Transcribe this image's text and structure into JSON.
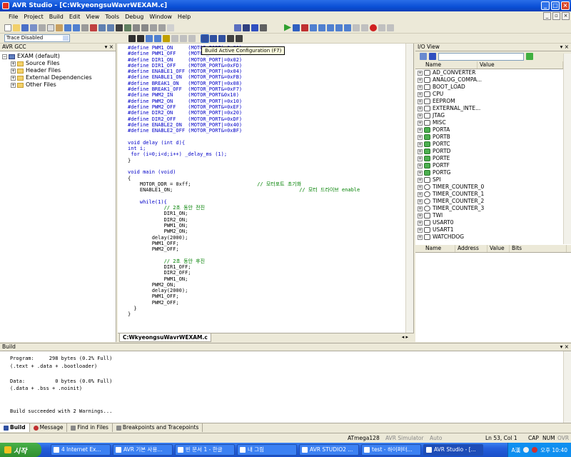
{
  "window": {
    "title": "AVR Studio - [C:WkyeongsuWavrWEXAM.c]"
  },
  "menu": [
    "File",
    "Project",
    "Build",
    "Edit",
    "View",
    "Tools",
    "Debug",
    "Window",
    "Help"
  ],
  "toolbar": {
    "trace": "Trace Disabled"
  },
  "tooltip": "Build Active Configuration (F7)",
  "left_pane": {
    "title": "AVR GCC",
    "root": "EXAM (default)",
    "items": [
      "Source Files",
      "Header Files",
      "External Dependencies",
      "Other Files"
    ]
  },
  "editor": {
    "tab": "C:WkyeongsuWavrWEXAM.c",
    "lines": [
      "#define PWM1_ON     (MOTOR_PORT|=0x01)",
      "#define PWM1_OFF    (MOTOR_PORT&=0xFE)",
      "#define DIR1_ON     (MOTOR_PORT|=0x02)",
      "#define DIR1_OFF    (MOTOR_PORT&=0xFD)",
      "#define ENABLE1_OFF (MOTOR_PORT|=0x04)",
      "#define ENABLE1_ON  (MOTOR_PORT&=0xFB)",
      "#define BREAK1_ON   (MOTOR_PORT|=0x08)",
      "#define BREAK1_OFF  (MOTOR_PORT&=0xF7)",
      "#define PWM2_IN     (MOTOR_PORT&0x10)",
      "#define PWM2_ON     (MOTOR_PORT|=0x10)",
      "#define PWM2_OFF    (MOTOR_PORT&=0xEF)",
      "#define DIR2_ON     (MOTOR_PORT|=0x20)",
      "#define DIR2_OFF    (MOTOR_PORT&=0xDF)",
      "#define ENABLE2_ON  (MOTOR_PORT|=0x40)",
      "#define ENABLE2_OFF (MOTOR_PORT&=0xBF)",
      "",
      "void delay (int d){",
      "int i;",
      " for (i=0;i<d;i++) _delay_ms (1);",
      "}",
      "",
      "void main (void)",
      "{",
      "    MOTOR_DDR = 0xff;                      // 모터포트 초기화",
      "    ENABLE1_ON;                                          // 모터 드라이브 enable",
      "",
      "    while(1){",
      "            // 2초 동안 전진",
      "            DIR1_ON;",
      "            DIR2_ON;",
      "            PWM1_ON;",
      "            PWM2_ON;",
      "        delay(2000);",
      "        PWM1_OFF;",
      "        PWM2_OFF;",
      "",
      "            // 2초 동안 후진",
      "            DIR1_OFF;",
      "            DIR2_OFF;",
      "            PWM1_ON;",
      "        PWM2_ON;",
      "        delay(2000);",
      "        PWM1_OFF;",
      "        PWM2_OFF;",
      "  }",
      "}"
    ]
  },
  "io_view": {
    "title": "I/O View",
    "col_name": "Name",
    "col_value": "Value",
    "items": [
      "AD_CONVERTER",
      "ANALOG_COMPA...",
      "BOOT_LOAD",
      "CPU",
      "EEPROM",
      "EXTERNAL_INTE...",
      "JTAG",
      "MISC",
      "PORTA",
      "PORTB",
      "PORTC",
      "PORTD",
      "PORTE",
      "PORTF",
      "PORTG",
      "SPI",
      "TIMER_COUNTER_0",
      "TIMER_COUNTER_1",
      "TIMER_COUNTER_2",
      "TIMER_COUNTER_3",
      "TWI",
      "USART0",
      "USART1",
      "WATCHDOG"
    ],
    "bottom_cols": [
      "Name",
      "Address",
      "Value",
      "Bits"
    ]
  },
  "build": {
    "title": "Build",
    "lines": [
      "Program:     298 bytes (0.2% Full)",
      "(.text + .data + .bootloader)",
      "",
      "Data:          0 bytes (0.0% Full)",
      "(.data + .bss + .noinit)",
      "",
      "",
      "Build succeeded with 2 Warnings..."
    ],
    "tabs": [
      "Build",
      "Message",
      "Find in Files",
      "Breakpoints and Tracepoints"
    ]
  },
  "status": {
    "device": "ATmega128",
    "sim": "AVR Simulator",
    "auto": "Auto",
    "pos": "Ln 53, Col 1",
    "caps": "CAP",
    "num": "NUM",
    "ovr": "OVR"
  },
  "taskbar": {
    "start": "시작",
    "tasks": [
      "4 Internet Ex...",
      "AVR 기본 사용...",
      "빈 문서 1 - 한글",
      "내 그림",
      "AVR STUDIO2 ...",
      "test - 하이퍼터...",
      "AVR Studio - [..."
    ],
    "clock": "오후 10:40",
    "ime": "A漢"
  }
}
